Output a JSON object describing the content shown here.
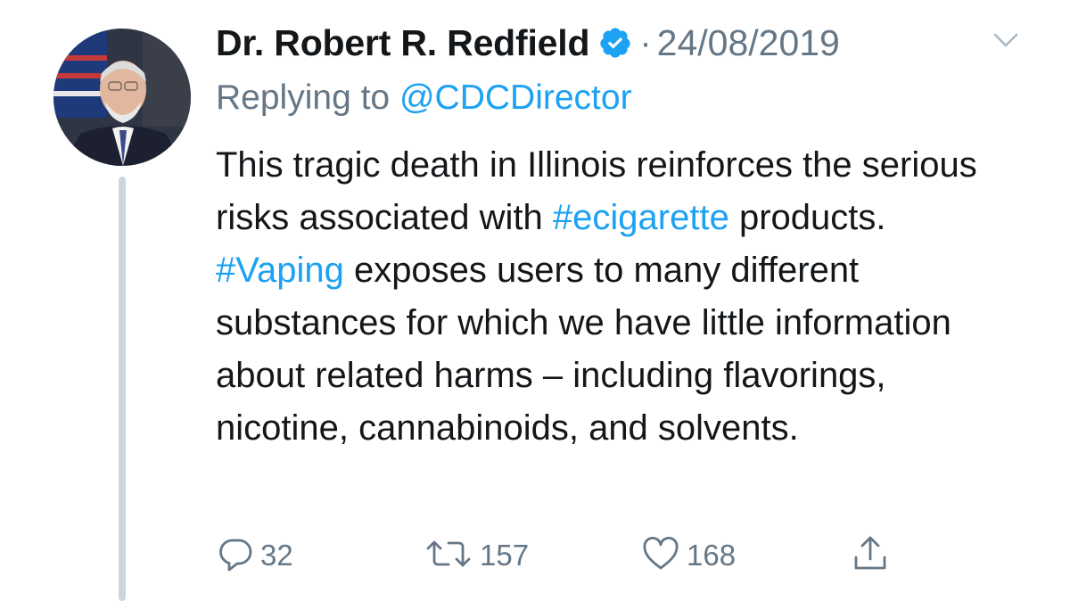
{
  "tweet": {
    "author_name": "Dr. Robert R. Redfield",
    "separator": "·",
    "date": "24/08/2019",
    "replying_prefix": "Replying to ",
    "replying_to": "@CDCDirector",
    "body": {
      "p1": "This tragic death in Illinois reinforces the serious risks associated with ",
      "hashtag1": "#ecigarette",
      "p2": " products. ",
      "hashtag2": "#Vaping",
      "p3": " exposes users to many different substances for which we have little information about related harms – including flavorings, nicotine, cannabinoids, and solvents."
    },
    "actions": {
      "reply_count": "32",
      "retweet_count": "157",
      "like_count": "168"
    }
  },
  "icons": {
    "verified": "verified-badge-icon",
    "caret": "chevron-down-icon",
    "reply": "reply-icon",
    "retweet": "retweet-icon",
    "like": "heart-icon",
    "share": "share-icon"
  },
  "colors": {
    "text": "#14171a",
    "secondary": "#657786",
    "accent": "#1da1f2",
    "thread_line": "#ccd6dd"
  }
}
